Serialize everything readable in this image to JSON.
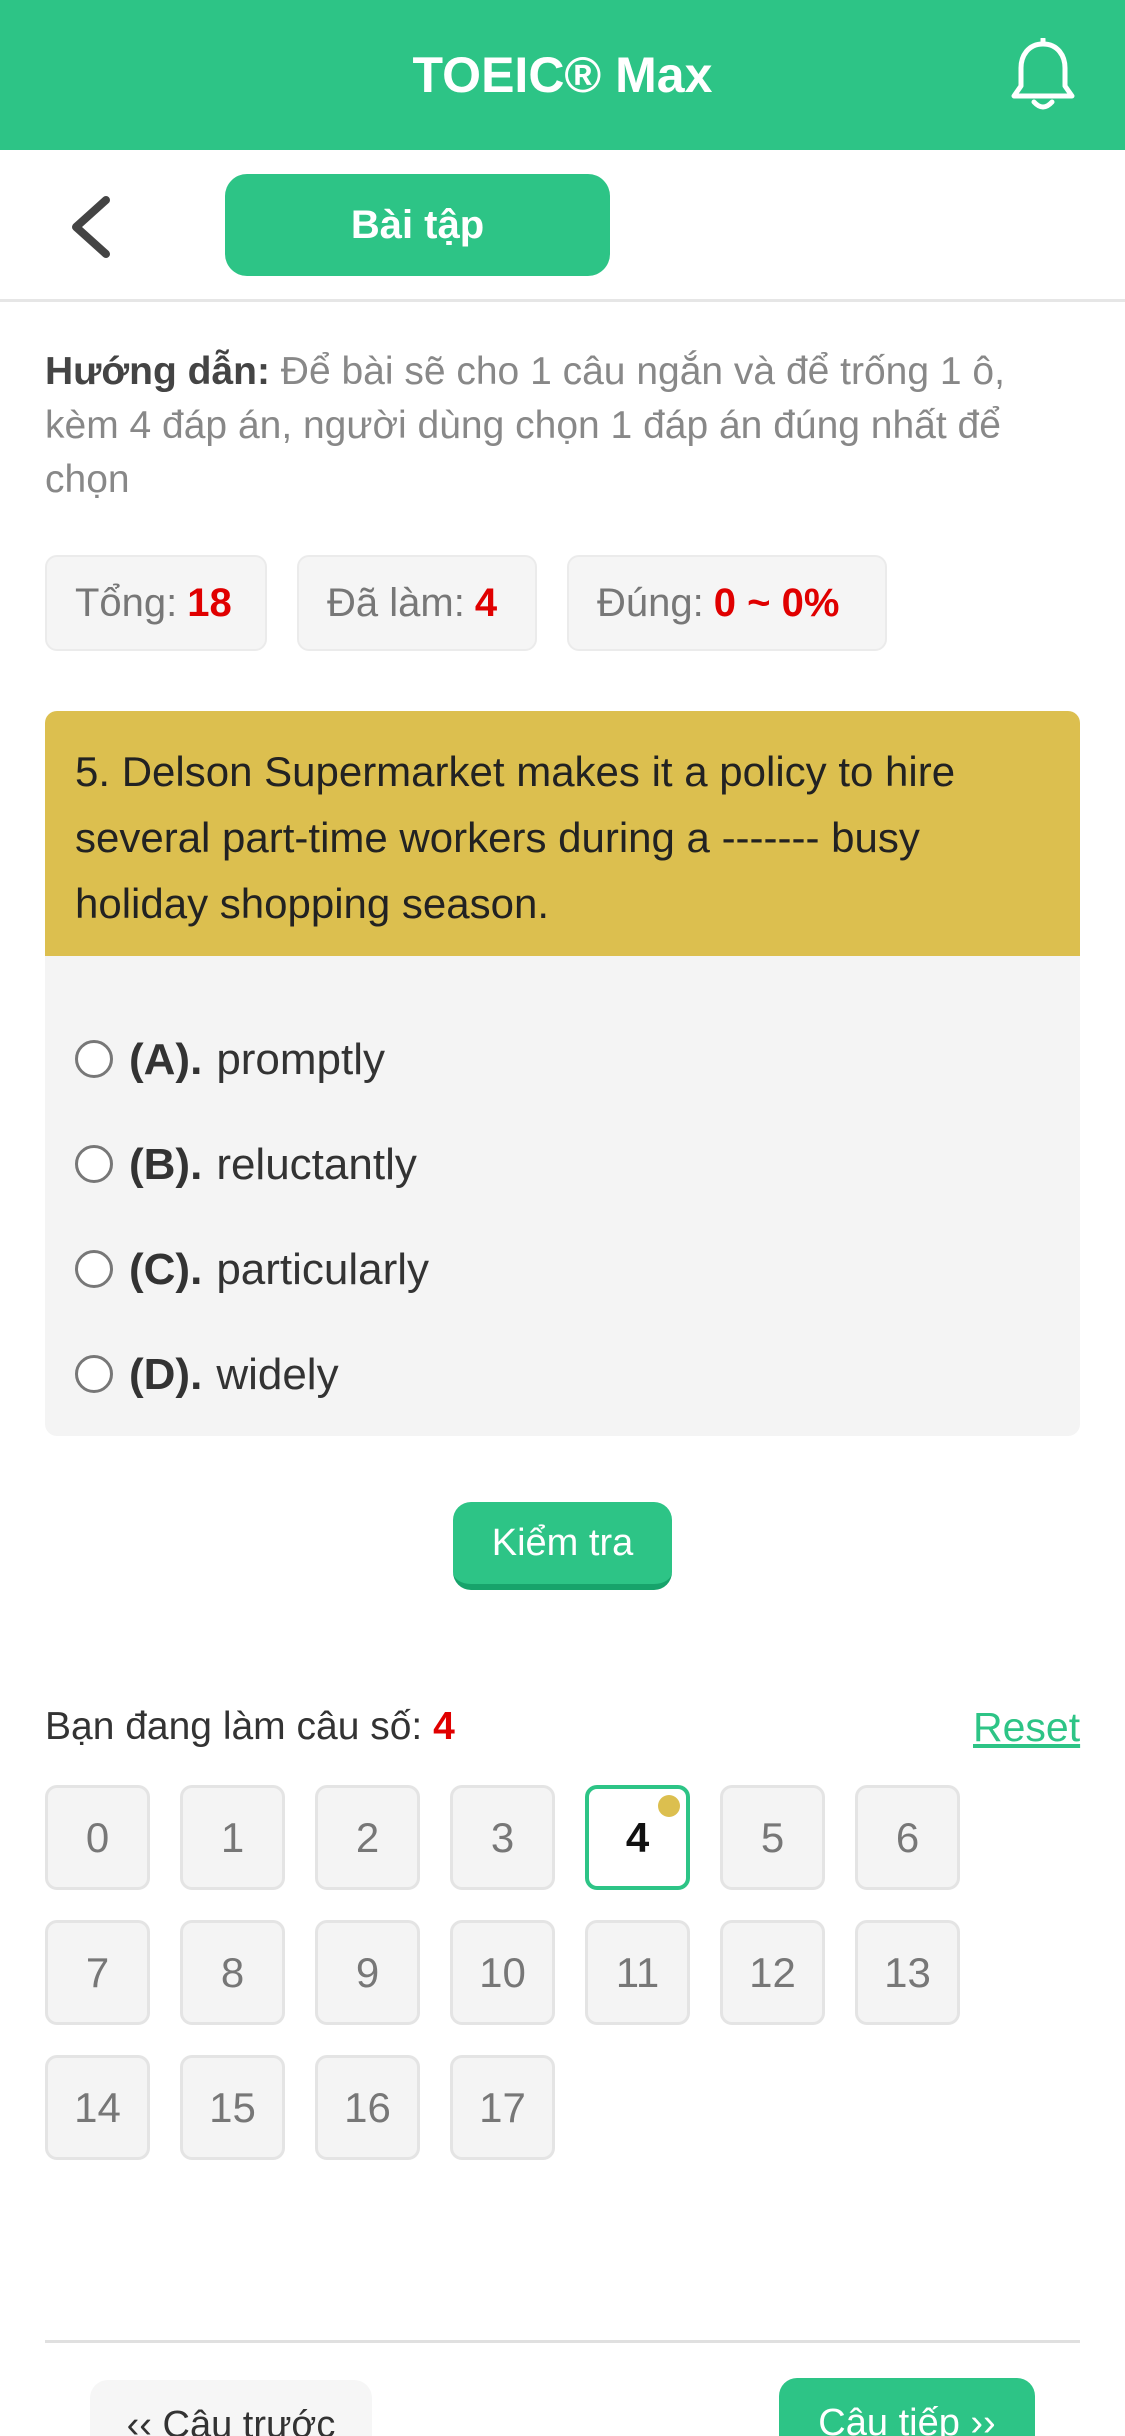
{
  "header": {
    "title": "TOEIC® Max",
    "bell_icon": "bell-icon"
  },
  "subheader": {
    "back_icon": "chevron-left-icon",
    "tab_label": "Bài tập"
  },
  "instructions": {
    "label": "Hướng dẫn:",
    "text": " Để bài sẽ cho 1 câu ngắn và để trống 1 ô, kèm 4 đáp án, người dùng chọn 1 đáp án đúng nhất để chọn"
  },
  "stats": {
    "total_label": "Tổng:",
    "total_value": "18",
    "done_label": "Đã làm:",
    "done_value": "4",
    "correct_label": "Đúng:",
    "correct_value": "0 ~ 0%"
  },
  "question": {
    "text": "5. Delson Supermarket makes it a policy to hire several part-time workers during a ------- busy holiday shopping season.",
    "options": [
      {
        "label": "(A).",
        "text": "promptly"
      },
      {
        "label": "(B).",
        "text": "reluctantly"
      },
      {
        "label": "(C).",
        "text": "particularly"
      },
      {
        "label": "(D).",
        "text": "widely"
      }
    ]
  },
  "check_button": "Kiểm tra",
  "progress": {
    "label": "Bạn đang làm câu số:",
    "current": "4",
    "reset": "Reset"
  },
  "question_grid": [
    "0",
    "1",
    "2",
    "3",
    "4",
    "5",
    "6",
    "7",
    "8",
    "9",
    "10",
    "11",
    "12",
    "13",
    "14",
    "15",
    "16",
    "17"
  ],
  "navigation": {
    "prev": "‹‹ Câu trước",
    "next": "Câu tiếp ››"
  },
  "colors": {
    "primary": "#2dc486",
    "question_bg": "#dcbf4f",
    "highlight": "#e00000"
  }
}
